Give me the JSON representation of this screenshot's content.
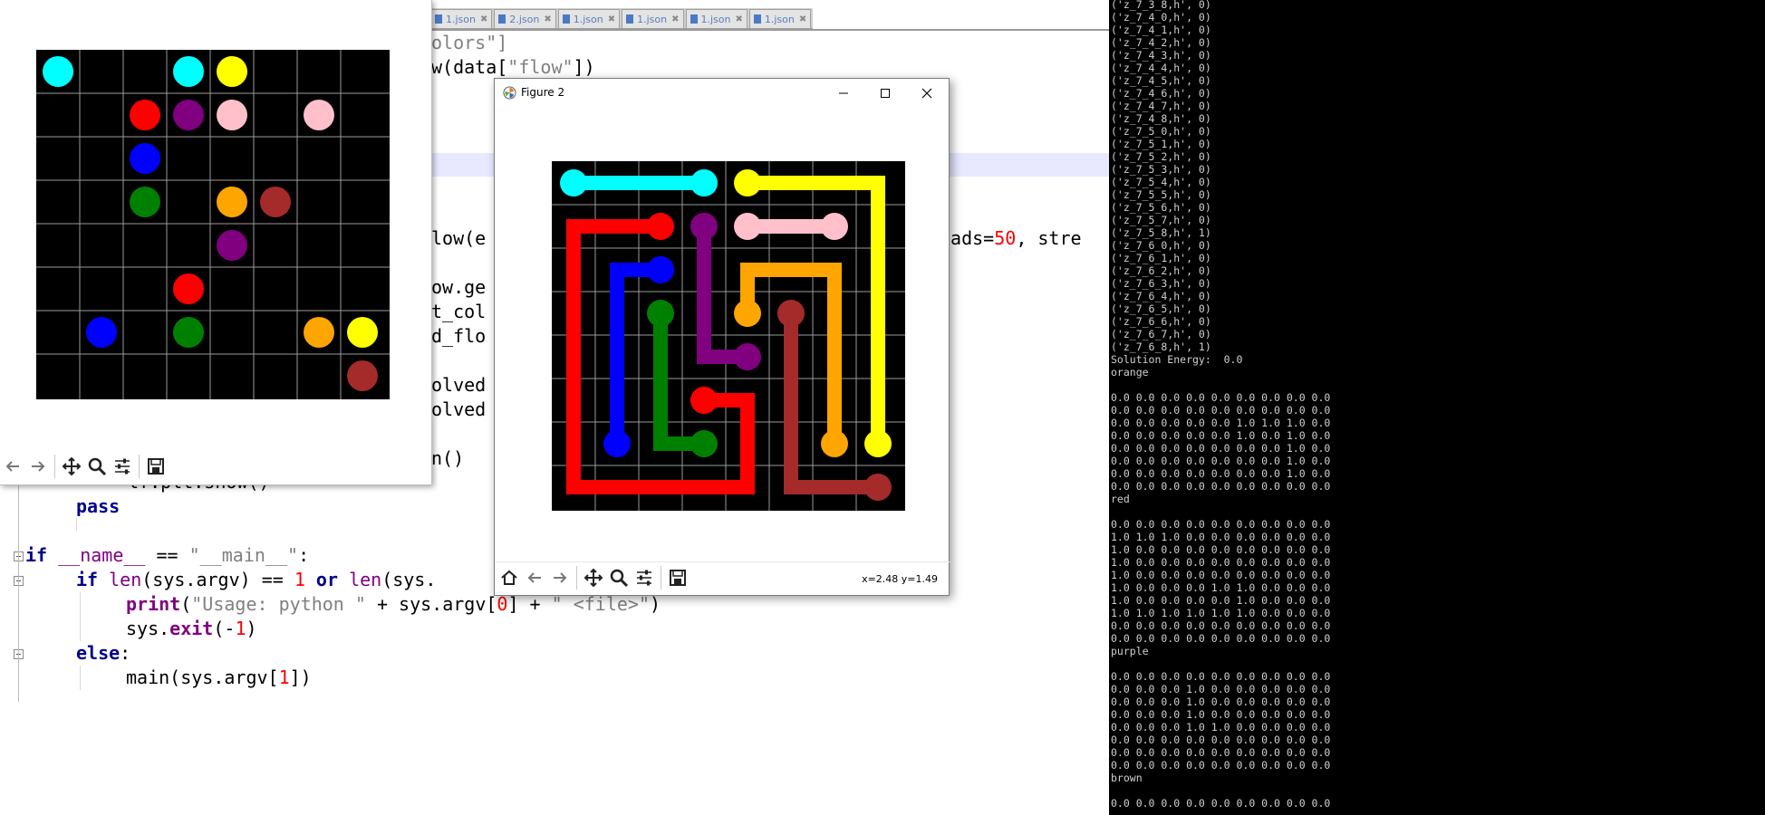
{
  "editor": {
    "tabs": [
      {
        "label": "1.json"
      },
      {
        "label": "2.json"
      },
      {
        "label": "1.json"
      },
      {
        "label": "1.json"
      },
      {
        "label": "1.json"
      },
      {
        "label": "1.json"
      }
    ],
    "code": {
      "l1_c": "olors\"]",
      "l2_a": "w(data[",
      "l2_s": "\"flow\"",
      "l2_b": "])",
      "l3_a": "low(e",
      "l3_c": "eads=",
      "l3_n": "50",
      "l3_d": ", stre",
      "l4": "ow.ge",
      "l5": "t_col",
      "l6": "d_flo",
      "l7": "olved",
      "l8": "olved",
      "l9": "n()",
      "l10": "lf.plt.show()",
      "pass": "pass",
      "if_kw": "if",
      "name_dunder": "__name__",
      "eq": " == ",
      "main_str": "\"__main__\"",
      "colon": ":",
      "if2_kw": "if",
      "len1": "len",
      "argv1": "(sys.argv) == ",
      "one": "1",
      "or_kw": " or ",
      "len2": "len",
      "argv2": "(sys.",
      "print_kw": "print",
      "p_open": "(",
      "usage_str": "\"Usage: python \"",
      "plus1": " + sys.argv[",
      "zero": "0",
      "plus2": "] + ",
      "file_str": "\" <file>\"",
      "p_close": ")",
      "sys_exit_a": "sys.",
      "exit_kw": "exit",
      "exit_open": "(-",
      "minus_one": "1",
      "exit_close": ")",
      "else_kw": "else",
      "else_colon": ":",
      "main_call": "main(sys.argv[",
      "one2": "1",
      "main_close": "])"
    }
  },
  "terminal": {
    "lines_vars": [
      "('z_7_3_8,h', 0)",
      "('z_7_4_0,h', 0)",
      "('z_7_4_1,h', 0)",
      "('z_7_4_2,h', 0)",
      "('z_7_4_3,h', 0)",
      "('z_7_4_4,h', 0)",
      "('z_7_4_5,h', 0)",
      "('z_7_4_6,h', 0)",
      "('z_7_4_7,h', 0)",
      "('z_7_4_8,h', 0)",
      "('z_7_5_0,h', 0)",
      "('z_7_5_1,h', 0)",
      "('z_7_5_2,h', 0)",
      "('z_7_5_3,h', 0)",
      "('z_7_5_4,h', 0)",
      "('z_7_5_5,h', 0)",
      "('z_7_5_6,h', 0)",
      "('z_7_5_7,h', 0)",
      "('z_7_5_8,h', 1)",
      "('z_7_6_0,h', 0)",
      "('z_7_6_1,h', 0)",
      "('z_7_6_2,h', 0)",
      "('z_7_6_3,h', 0)",
      "('z_7_6_4,h', 0)",
      "('z_7_6_5,h', 0)",
      "('z_7_6_6,h', 0)",
      "('z_7_6_7,h', 0)",
      "('z_7_6_8,h', 1)"
    ],
    "energy": "Solution Energy:  0.0",
    "orange_label": "orange",
    "orange_rows": [
      "0.0 0.0 0.0 0.0 0.0 0.0 0.0 0.0 0.0",
      "0.0 0.0 0.0 0.0 0.0 0.0 0.0 0.0 0.0",
      "0.0 0.0 0.0 0.0 0.0 1.0 1.0 1.0 0.0",
      "0.0 0.0 0.0 0.0 0.0 1.0 0.0 1.0 0.0",
      "0.0 0.0 0.0 0.0 0.0 0.0 0.0 1.0 0.0",
      "0.0 0.0 0.0 0.0 0.0 0.0 0.0 1.0 0.0",
      "0.0 0.0 0.0 0.0 0.0 0.0 0.0 1.0 0.0",
      "0.0 0.0 0.0 0.0 0.0 0.0 0.0 0.0 0.0"
    ],
    "red_label": "red",
    "red_rows": [
      "0.0 0.0 0.0 0.0 0.0 0.0 0.0 0.0 0.0",
      "1.0 1.0 1.0 0.0 0.0 0.0 0.0 0.0 0.0",
      "1.0 0.0 0.0 0.0 0.0 0.0 0.0 0.0 0.0",
      "1.0 0.0 0.0 0.0 0.0 0.0 0.0 0.0 0.0",
      "1.0 0.0 0.0 0.0 0.0 0.0 0.0 0.0 0.0",
      "1.0 0.0 0.0 0.0 1.0 1.0 0.0 0.0 0.0",
      "1.0 0.0 0.0 0.0 0.0 1.0 0.0 0.0 0.0",
      "1.0 1.0 1.0 1.0 1.0 1.0 0.0 0.0 0.0",
      "0.0 0.0 0.0 0.0 0.0 0.0 0.0 0.0 0.0",
      "0.0 0.0 0.0 0.0 0.0 0.0 0.0 0.0 0.0"
    ],
    "purple_label": "purple",
    "purple_rows": [
      "0.0 0.0 0.0 0.0 0.0 0.0 0.0 0.0 0.0",
      "0.0 0.0 0.0 1.0 0.0 0.0 0.0 0.0 0.0",
      "0.0 0.0 0.0 1.0 0.0 0.0 0.0 0.0 0.0",
      "0.0 0.0 0.0 1.0 0.0 0.0 0.0 0.0 0.0",
      "0.0 0.0 0.0 1.0 1.0 0.0 0.0 0.0 0.0",
      "0.0 0.0 0.0 0.0 0.0 0.0 0.0 0.0 0.0",
      "0.0 0.0 0.0 0.0 0.0 0.0 0.0 0.0 0.0",
      "0.0 0.0 0.0 0.0 0.0 0.0 0.0 0.0 0.0"
    ],
    "brown_label": "brown",
    "brown_rows": [
      "0.0 0.0 0.0 0.0 0.0 0.0 0.0 0.0 0.0"
    ]
  },
  "figure1": {
    "icons": [
      "arrow-left-icon",
      "arrow-right-icon",
      "pan-icon",
      "zoom-icon",
      "configure-icon",
      "save-icon"
    ],
    "grid": {
      "cols": 8,
      "rows": 8
    },
    "dots": [
      {
        "col": 0,
        "row": 0,
        "color": "#00ffff"
      },
      {
        "col": 3,
        "row": 0,
        "color": "#00ffff"
      },
      {
        "col": 4,
        "row": 0,
        "color": "#ffff00"
      },
      {
        "col": 2,
        "row": 1,
        "color": "#ff0000"
      },
      {
        "col": 3,
        "row": 1,
        "color": "#800080"
      },
      {
        "col": 4,
        "row": 1,
        "color": "#ffc0cb"
      },
      {
        "col": 6,
        "row": 1,
        "color": "#ffc0cb"
      },
      {
        "col": 2,
        "row": 2,
        "color": "#0000ff"
      },
      {
        "col": 2,
        "row": 3,
        "color": "#008000"
      },
      {
        "col": 4,
        "row": 3,
        "color": "#ffa500"
      },
      {
        "col": 5,
        "row": 3,
        "color": "#a52a2a"
      },
      {
        "col": 4,
        "row": 4,
        "color": "#800080"
      },
      {
        "col": 3,
        "row": 5,
        "color": "#ff0000"
      },
      {
        "col": 1,
        "row": 6,
        "color": "#0000ff"
      },
      {
        "col": 3,
        "row": 6,
        "color": "#008000"
      },
      {
        "col": 6,
        "row": 6,
        "color": "#ffa500"
      },
      {
        "col": 7,
        "row": 6,
        "color": "#ffff00"
      },
      {
        "col": 7,
        "row": 7,
        "color": "#a52a2a"
      }
    ]
  },
  "figure2": {
    "title": "Figure 2",
    "min_icon": "minimize-icon",
    "max_icon": "maximize-icon",
    "close_icon": "close-icon",
    "coords": "x=2.48 y=1.49",
    "icons": [
      "home-icon",
      "arrow-left-icon",
      "arrow-right-icon",
      "pan-icon",
      "zoom-icon",
      "configure-icon",
      "save-icon"
    ],
    "grid": {
      "cols": 8,
      "rows": 8
    },
    "paths": [
      {
        "color": "#00ffff",
        "cells": [
          [
            0,
            0
          ],
          [
            1,
            0
          ],
          [
            2,
            0
          ],
          [
            3,
            0
          ]
        ]
      },
      {
        "color": "#ffff00",
        "cells": [
          [
            4,
            0
          ],
          [
            5,
            0
          ],
          [
            6,
            0
          ],
          [
            7,
            0
          ],
          [
            7,
            1
          ],
          [
            7,
            2
          ],
          [
            7,
            3
          ],
          [
            7,
            4
          ],
          [
            7,
            5
          ],
          [
            7,
            6
          ]
        ]
      },
      {
        "color": "#ffc0cb",
        "cells": [
          [
            4,
            1
          ],
          [
            5,
            1
          ],
          [
            6,
            1
          ]
        ]
      },
      {
        "color": "#ff0000",
        "cells": [
          [
            2,
            1
          ],
          [
            1,
            1
          ],
          [
            0,
            1
          ],
          [
            0,
            2
          ],
          [
            0,
            3
          ],
          [
            0,
            4
          ],
          [
            0,
            5
          ],
          [
            0,
            6
          ],
          [
            0,
            7
          ],
          [
            1,
            7
          ],
          [
            2,
            7
          ],
          [
            3,
            7
          ],
          [
            4,
            7
          ],
          [
            4,
            6
          ],
          [
            4,
            5
          ],
          [
            3,
            5
          ]
        ]
      },
      {
        "color": "#800080",
        "cells": [
          [
            3,
            1
          ],
          [
            3,
            2
          ],
          [
            3,
            3
          ],
          [
            3,
            4
          ],
          [
            4,
            4
          ]
        ]
      },
      {
        "color": "#0000ff",
        "cells": [
          [
            2,
            2
          ],
          [
            1,
            2
          ],
          [
            1,
            3
          ],
          [
            1,
            4
          ],
          [
            1,
            5
          ],
          [
            1,
            6
          ]
        ]
      },
      {
        "color": "#008000",
        "cells": [
          [
            2,
            3
          ],
          [
            2,
            4
          ],
          [
            2,
            5
          ],
          [
            2,
            6
          ],
          [
            3,
            6
          ]
        ]
      },
      {
        "color": "#ffa500",
        "cells": [
          [
            4,
            3
          ],
          [
            4,
            2
          ],
          [
            5,
            2
          ],
          [
            6,
            2
          ],
          [
            6,
            3
          ],
          [
            6,
            4
          ],
          [
            6,
            5
          ],
          [
            6,
            6
          ]
        ]
      },
      {
        "color": "#a52a2a",
        "cells": [
          [
            5,
            3
          ],
          [
            5,
            4
          ],
          [
            5,
            5
          ],
          [
            5,
            6
          ],
          [
            5,
            7
          ],
          [
            6,
            7
          ],
          [
            7,
            7
          ]
        ]
      }
    ]
  }
}
